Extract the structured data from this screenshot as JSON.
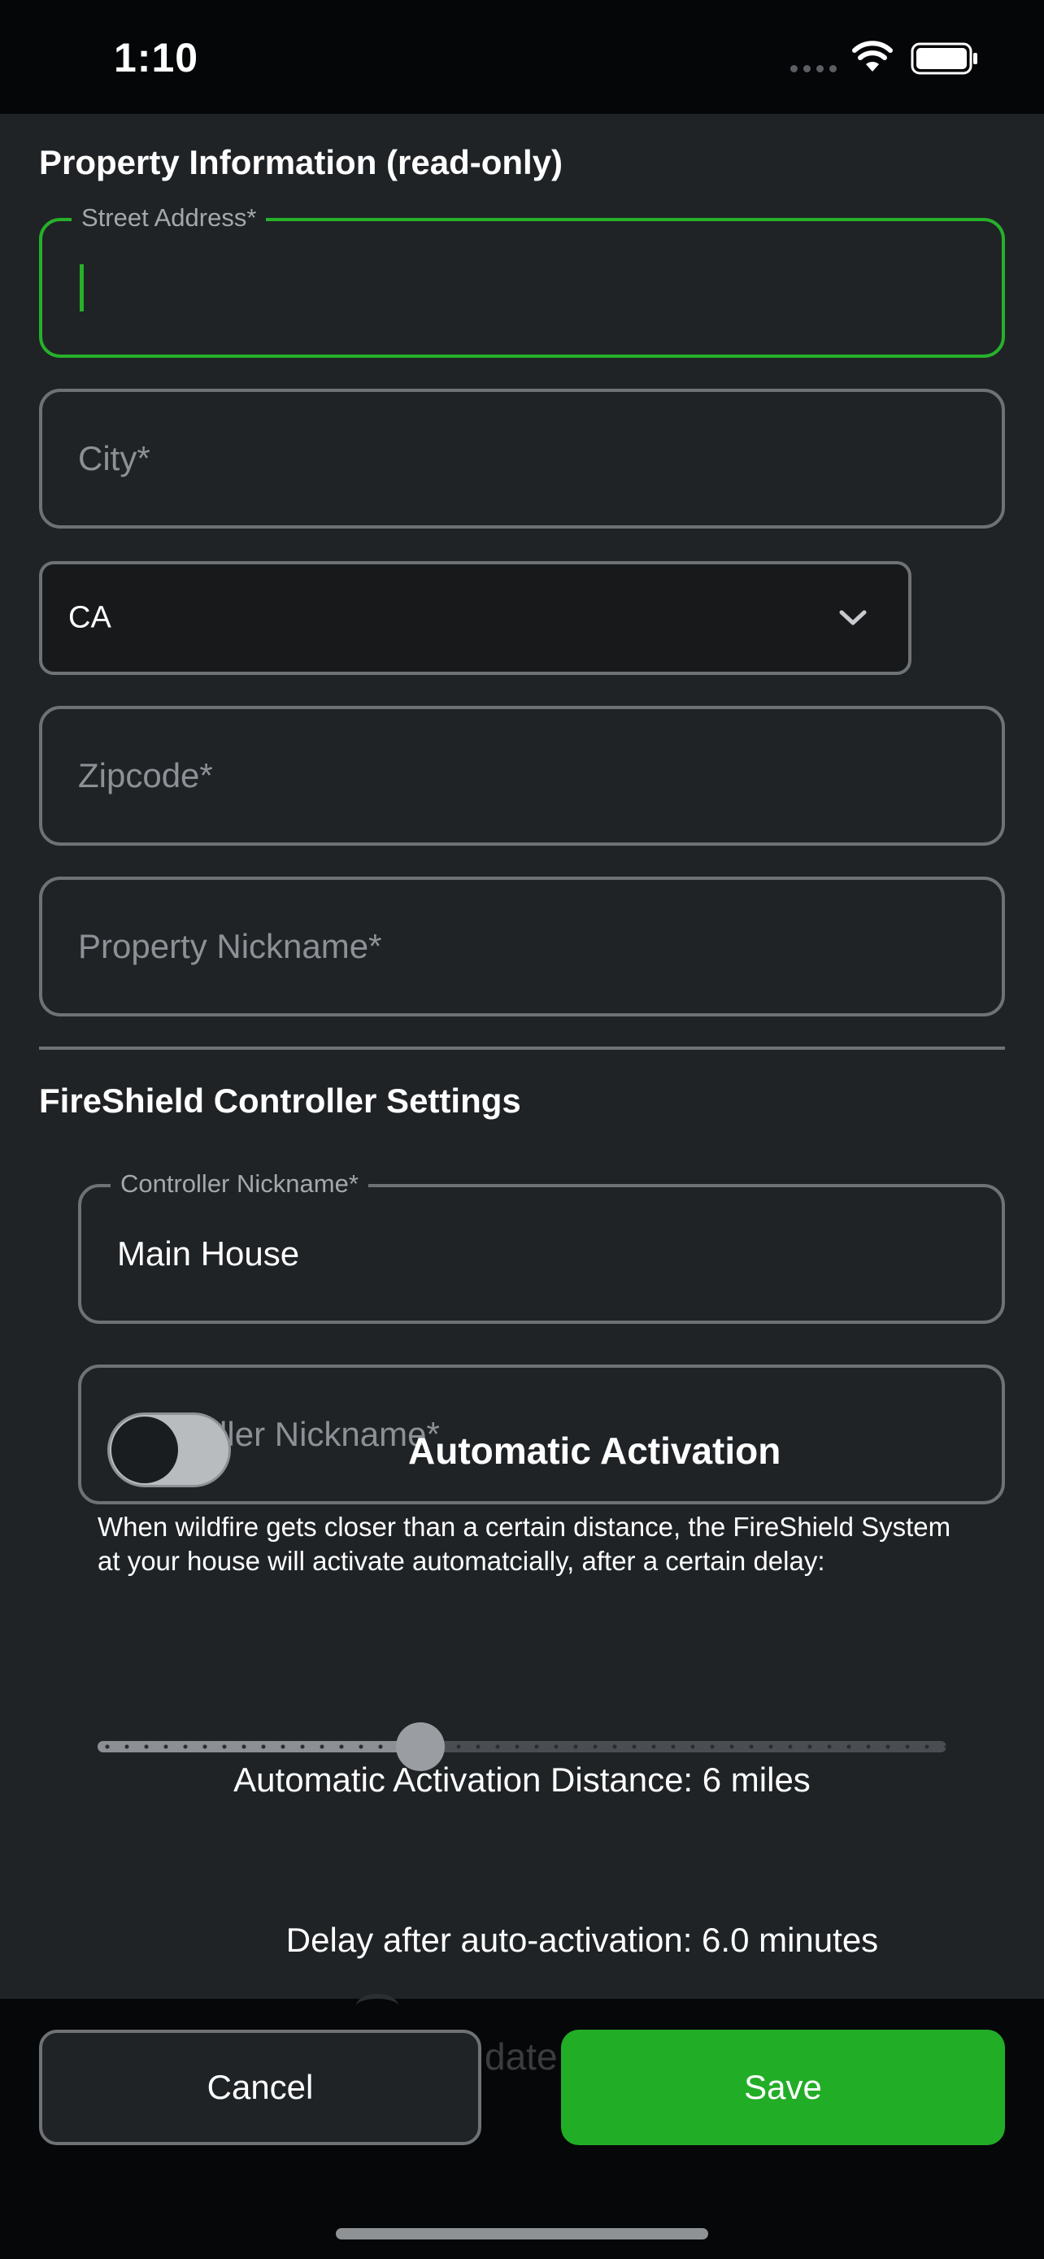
{
  "status_bar": {
    "time": "1:10"
  },
  "property_section": {
    "title": "Property Information (read-only)",
    "street_address": {
      "label": "Street Address*",
      "value": ""
    },
    "city": {
      "placeholder": "City*"
    },
    "state": {
      "value": "CA"
    },
    "zipcode": {
      "placeholder": "Zipcode*"
    },
    "nickname": {
      "placeholder": "Property Nickname*"
    }
  },
  "controller_section": {
    "title": "FireShield Controller Settings",
    "controller_nickname_1": {
      "label": "Controller Nickname*",
      "value": "Main House"
    },
    "controller_nickname_2": {
      "placeholder": "Controller Nickname*"
    },
    "auto_activation": {
      "label": "Automatic Activation",
      "enabled": false,
      "description": "When wildfire gets closer than a certain distance, the FireShield System at your house will activate automatcially, after a certain delay:"
    },
    "distance": {
      "caption": "Automatic Activation Distance: 6 miles",
      "value_fraction": 0.38
    },
    "delay": {
      "caption": "Delay after auto-activation: 6.0 minutes"
    }
  },
  "footer": {
    "ghost_text": "date",
    "cancel_label": "Cancel",
    "save_label": "Save"
  },
  "colors": {
    "accent": "#27b02a",
    "save_button": "#22ad27",
    "background": "#1f2326"
  }
}
